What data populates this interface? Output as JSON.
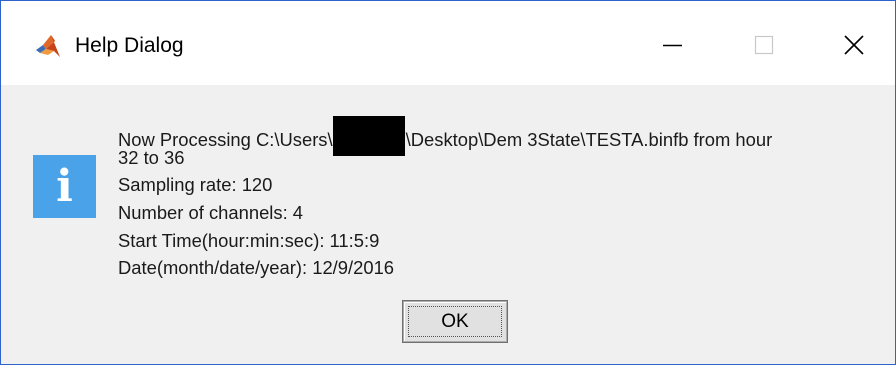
{
  "window": {
    "title": "Help Dialog",
    "app_icon": "matlab-icon",
    "controls": {
      "minimize_icon": "minimize-icon",
      "maximize_icon": "maximize-icon",
      "close_icon": "close-icon"
    }
  },
  "dialog": {
    "icon": "info-icon",
    "icon_glyph": "i",
    "icon_color": "#4aa3e8",
    "message": {
      "line1_prefix": "Now Processing C:\\Users\\",
      "line1_suffix": "\\Desktop\\Dem 3State\\TESTA.binfb from hour",
      "line2": "32 to 36",
      "line3": "Sampling rate: 120",
      "line4": "Number of channels: 4",
      "line5": "Start Time(hour:min:sec): 11:5:9",
      "line6": "Date(month/date/year): 12/9/2016"
    },
    "ok_label": "OK"
  },
  "colors": {
    "window_border": "#2f63c9",
    "titlebar_bg": "#ffffff",
    "body_bg": "#f0f0f0"
  }
}
